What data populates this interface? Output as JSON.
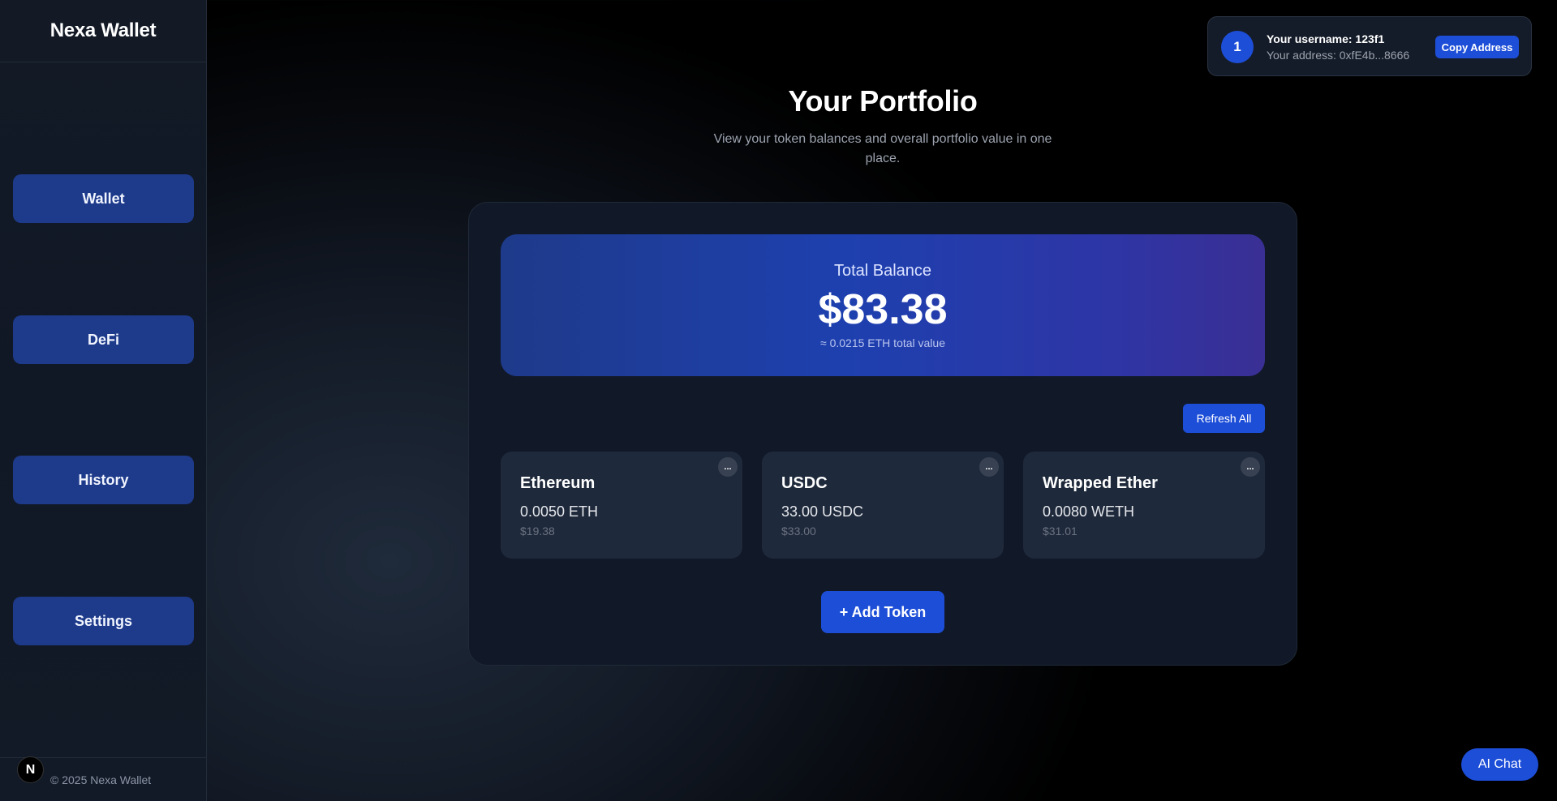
{
  "sidebar": {
    "brand": "Nexa Wallet",
    "items": [
      {
        "label": "Wallet"
      },
      {
        "label": "DeFi"
      },
      {
        "label": "History"
      },
      {
        "label": "Settings"
      }
    ],
    "footer": "© 2025 Nexa Wallet",
    "badge_letter": "N"
  },
  "user": {
    "avatar_text": "1",
    "username_line": "Your username: 123f1",
    "address_line": "Your address: 0xfE4b...8666",
    "copy_label": "Copy Address"
  },
  "main": {
    "title": "Your Portfolio",
    "subtitle": "View your token balances and overall portfolio value in one place.",
    "balance": {
      "label": "Total Balance",
      "value": "$83.38",
      "eth_value": "≈ 0.0215 ETH total value"
    },
    "refresh_label": "Refresh All",
    "tokens": [
      {
        "name": "Ethereum",
        "amount": "0.0050 ETH",
        "usd": "$19.38",
        "menu": "..."
      },
      {
        "name": "USDC",
        "amount": "33.00 USDC",
        "usd": "$33.00",
        "menu": "..."
      },
      {
        "name": "Wrapped Ether",
        "amount": "0.0080 WETH",
        "usd": "$31.01",
        "menu": "..."
      }
    ],
    "add_label": "+ Add Token"
  },
  "ai_chat_label": "AI Chat",
  "colors": {
    "accent": "#1d4ed8",
    "nav_button": "#1e3a8a",
    "card": "#1e293b",
    "panel": "#111827"
  }
}
